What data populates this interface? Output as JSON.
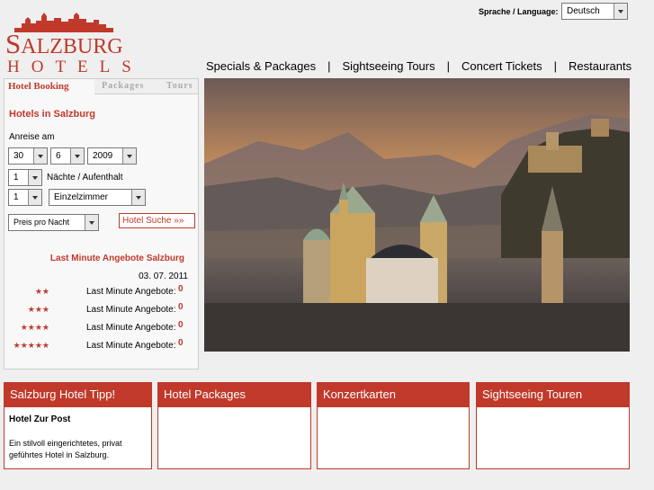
{
  "logo": {
    "brand_big": "S",
    "brand_rest": "ALZBURG",
    "sub": "HOTELS"
  },
  "language": {
    "label": "Sprache / Language:",
    "selected": "Deutsch"
  },
  "topnav": [
    "Specials & Packages",
    "Sightseeing Tours",
    "Concert Tickets",
    "Restaurants"
  ],
  "topnav_sep": "|",
  "tabs": [
    "Hotel Booking",
    "Packages",
    "Tours"
  ],
  "booking": {
    "heading": "Hotels in Salzburg",
    "arrival_label": "Anreise am",
    "day": "30",
    "month": "6",
    "year": "2009",
    "nights": "1",
    "nights_label": "Nächte / Aufenthalt",
    "rooms": "1",
    "room_type": "Einzelzimmer",
    "price_mode": "Preis pro Nacht",
    "search_button": "Hotel Suche »»"
  },
  "last_minute": {
    "title": "Last Minute Angebote Salzburg",
    "date": "03. 07. 2011",
    "rows": [
      {
        "stars": "★★",
        "label": "Last Minute Angebote:",
        "count": "0"
      },
      {
        "stars": "★★★",
        "label": "Last Minute Angebote:",
        "count": "0"
      },
      {
        "stars": "★★★★",
        "label": "Last Minute Angebote:",
        "count": "0"
      },
      {
        "stars": "★★★★★",
        "label": "Last Minute Angebote:",
        "count": "0"
      }
    ]
  },
  "boxes": [
    {
      "title": "Salzburg Hotel Tipp!",
      "subtitle": "Hotel Zur Post",
      "text": "Ein stilvoll eingerichtetes, privat geführtes Hotel in Salzburg."
    },
    {
      "title": "Hotel Packages"
    },
    {
      "title": "Konzertkarten"
    },
    {
      "title": "Sightseeing Touren"
    }
  ],
  "colors": {
    "accent": "#c0392b",
    "background": "#efefef"
  }
}
